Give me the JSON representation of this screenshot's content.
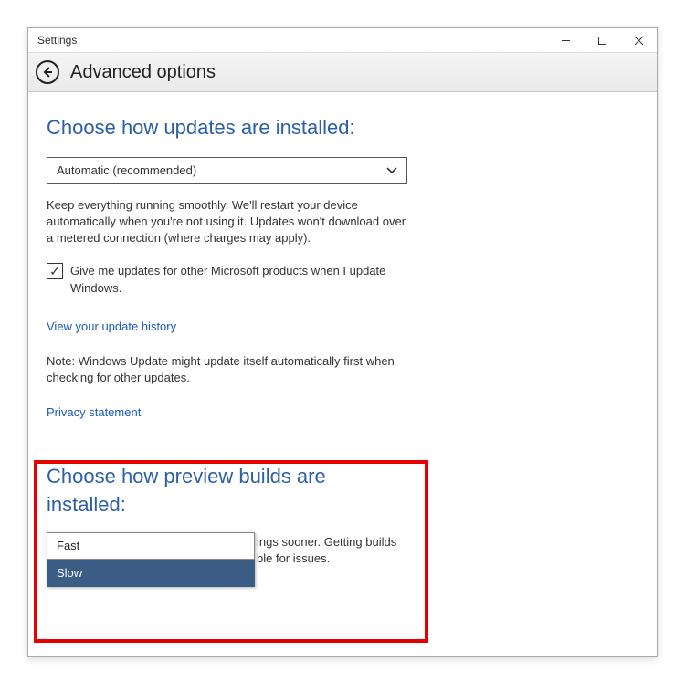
{
  "titlebar": {
    "title": "Settings"
  },
  "header": {
    "page_title": "Advanced options"
  },
  "updates": {
    "heading": "Choose how updates are installed:",
    "combo_value": "Automatic (recommended)",
    "description": "Keep everything running smoothly. We'll restart your device automatically when you're not using it. Updates won't download over a metered connection (where charges may apply).",
    "checkbox_label": "Give me updates for other Microsoft products when I update Windows.",
    "history_link": "View your update history",
    "note": "Note: Windows Update might update itself automatically first when checking for other updates.",
    "privacy_link": "Privacy statement"
  },
  "preview": {
    "heading": "Choose how preview builds are installed:",
    "partial_text_1": "ings sooner. Getting builds",
    "partial_text_2": "ble for issues.",
    "options": {
      "fast": "Fast",
      "slow": "Slow"
    }
  }
}
